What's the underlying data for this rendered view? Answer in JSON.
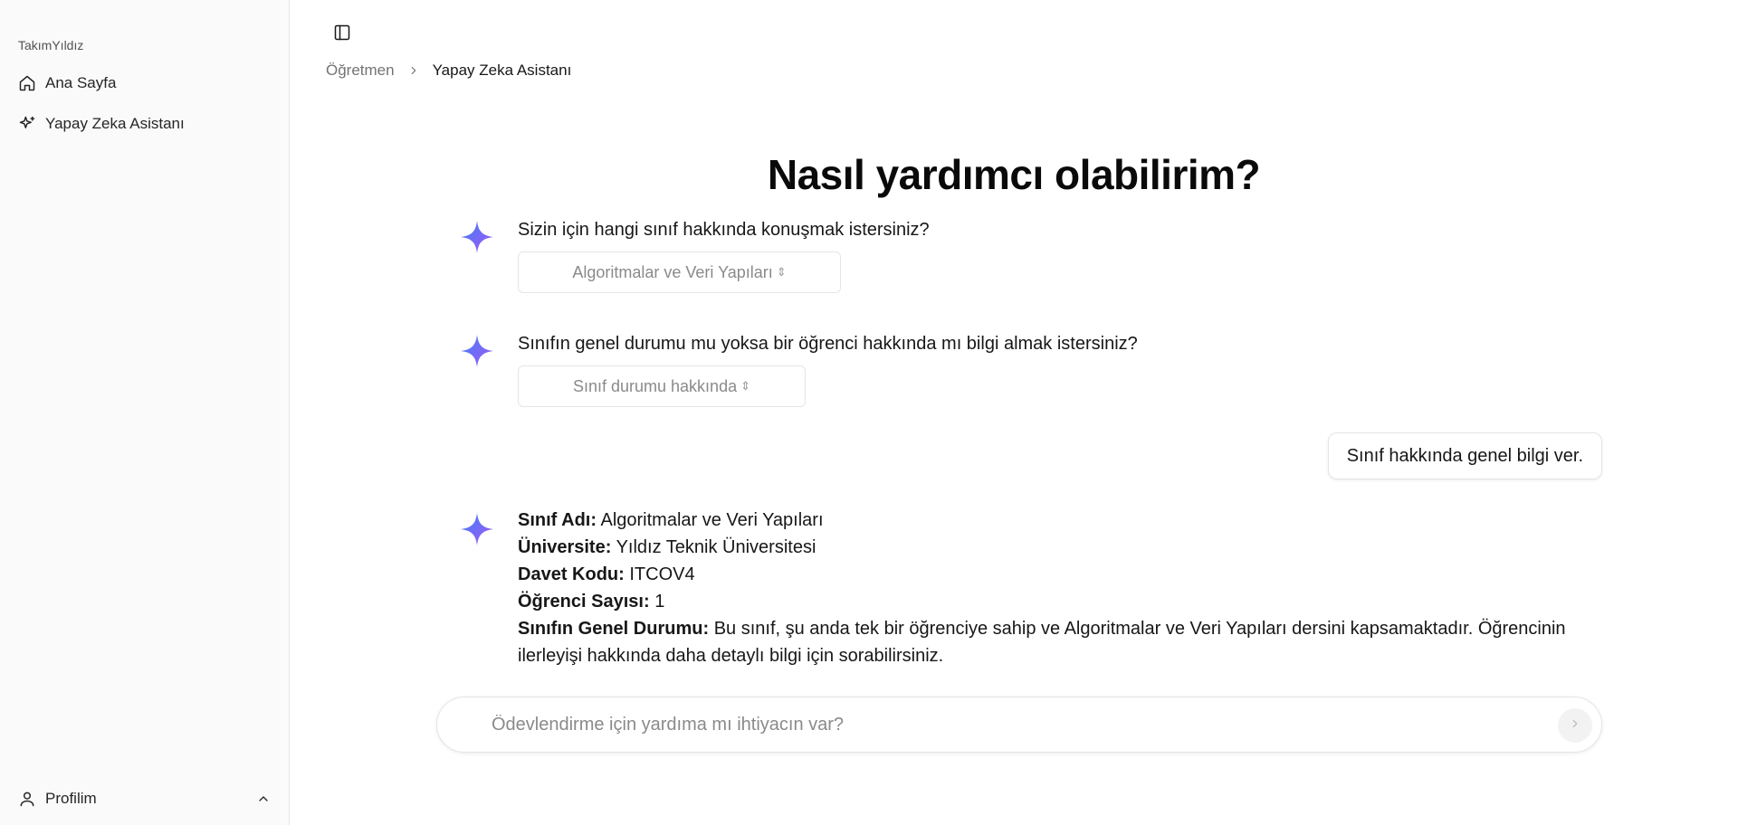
{
  "sidebar": {
    "brand": "TakımYıldız",
    "items": [
      {
        "label": "Ana Sayfa",
        "icon": "home-icon"
      },
      {
        "label": "Yapay Zeka Asistanı",
        "icon": "sparkles-icon"
      }
    ],
    "profile_label": "Profilim"
  },
  "breadcrumb": {
    "parent": "Öğretmen",
    "current": "Yapay Zeka Asistanı"
  },
  "main": {
    "title": "Nasıl yardımcı olabilirim?",
    "q1": {
      "text": "Sizin için hangi sınıf hakkında konuşmak istersiniz?",
      "selected": "Algoritmalar ve Veri Yapıları"
    },
    "q2": {
      "text": "Sınıfın genel durumu mu yoksa bir öğrenci hakkında mı bilgi almak istersiniz?",
      "selected": "Sınıf durumu hakkında"
    },
    "user_message": "Sınıf hakkında genel bilgi ver.",
    "answer": {
      "class_name_label": "Sınıf Adı:",
      "class_name": "Algoritmalar ve Veri Yapıları",
      "university_label": "Üniversite:",
      "university": "Yıldız Teknik Üniversitesi",
      "invite_label": "Davet Kodu:",
      "invite_code": "ITCOV4",
      "student_count_label": "Öğrenci Sayısı:",
      "student_count": "1",
      "status_label": "Sınıfın Genel Durumu:",
      "status": "Bu sınıf, şu anda tek bir öğrenciye sahip ve Algoritmalar ve Veri Yapıları dersini kapsamaktadır. Öğrencinin ilerleyişi hakkında daha detaylı bilgi için sorabilirsiniz."
    },
    "composer": {
      "placeholder": "Ödevlendirme için yardıma mı ihtiyacın var?",
      "value": ""
    }
  },
  "colors": {
    "sidebar_bg": "#fafafa",
    "border": "#e5e5e5",
    "spark_start": "#3b82f6",
    "spark_end": "#a855f7"
  }
}
